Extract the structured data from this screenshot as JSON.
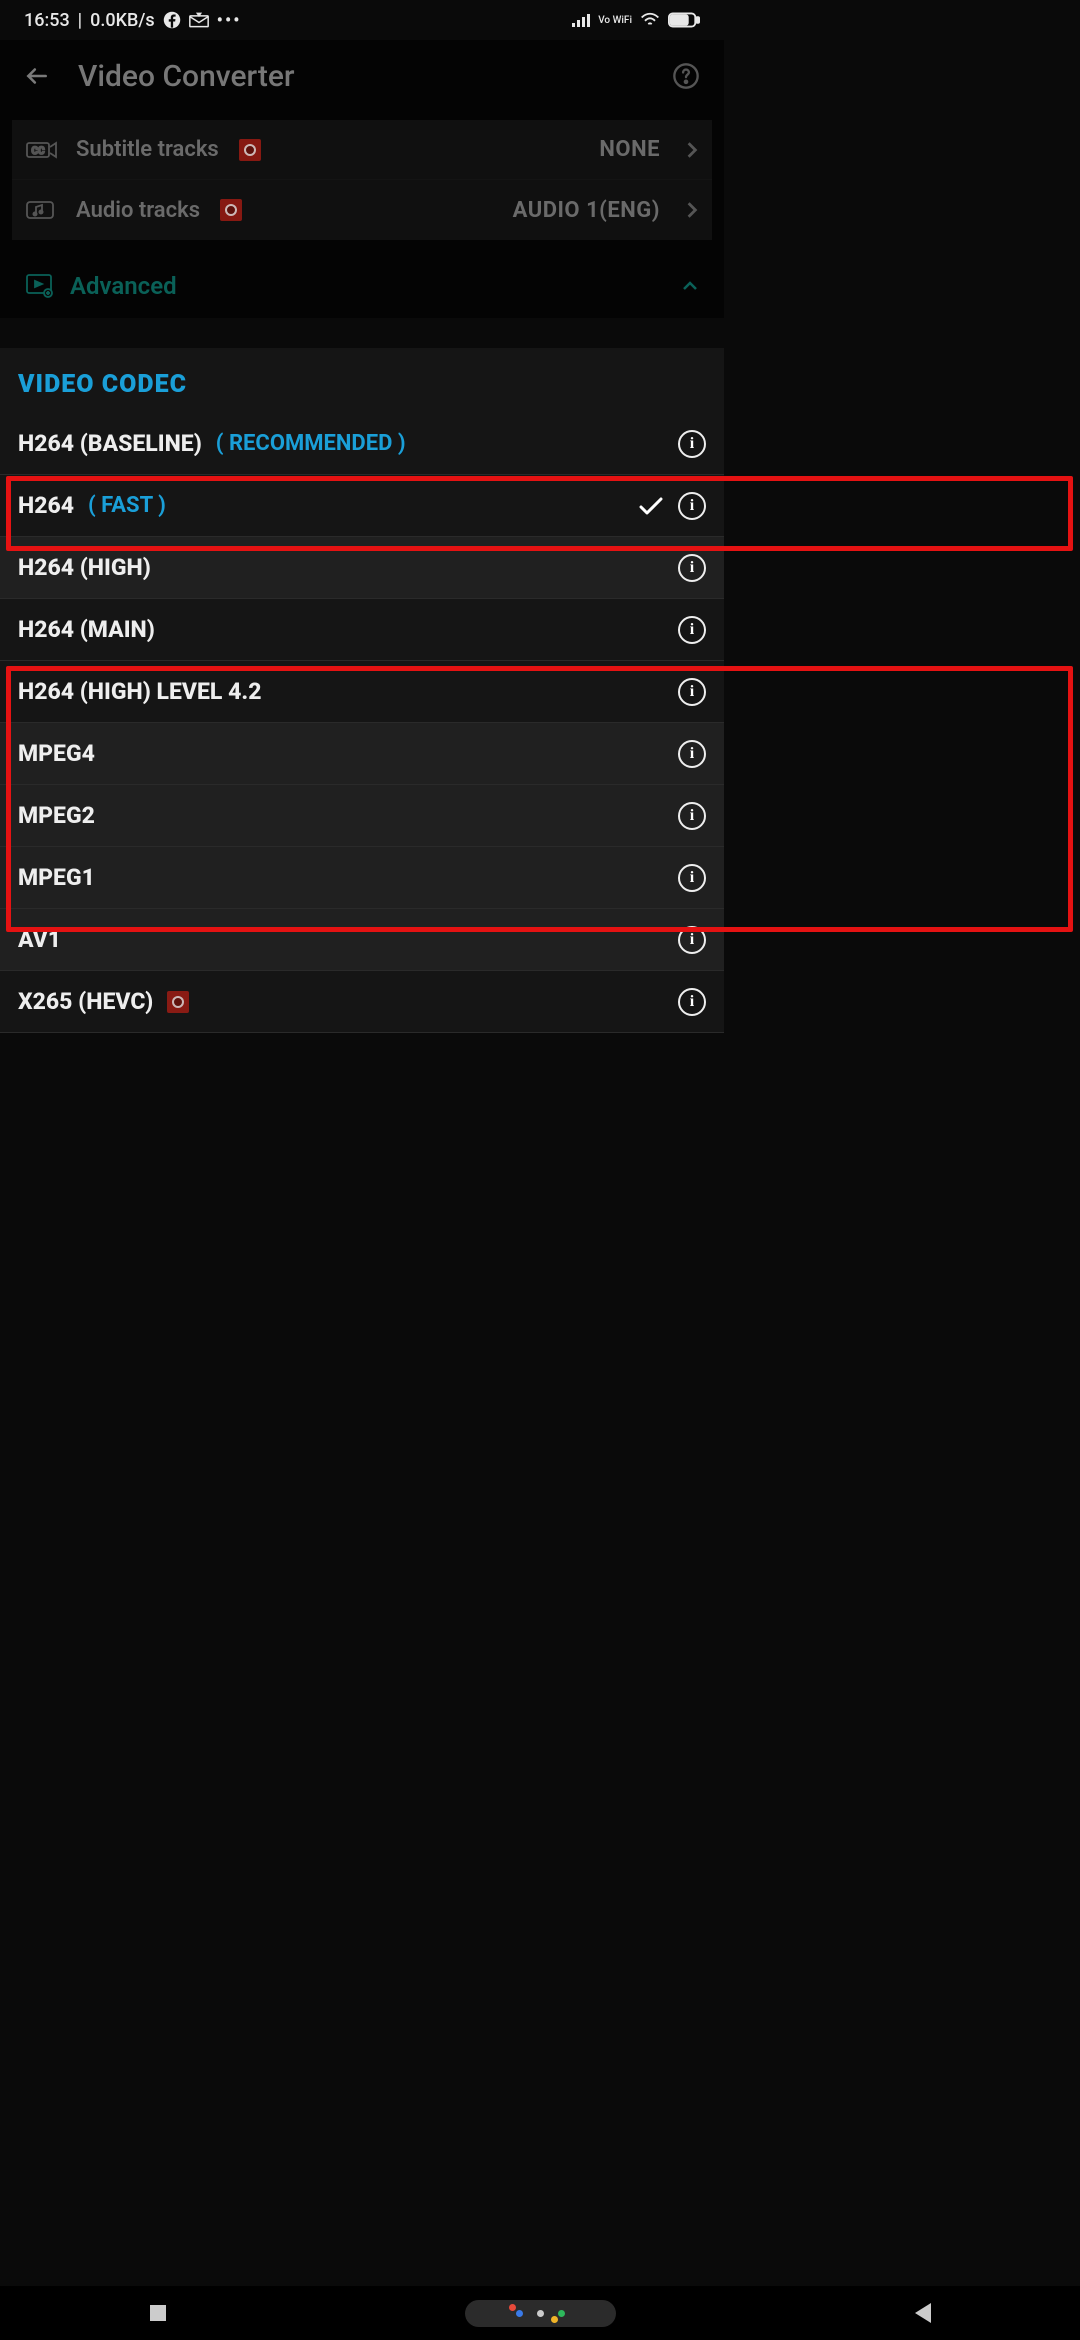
{
  "status": {
    "time": "16:53",
    "net": "0.0KB/s",
    "vowifi": "Vo WiFi"
  },
  "header": {
    "title": "Video Converter"
  },
  "settings": {
    "subtitle": {
      "label": "Subtitle tracks",
      "value": "NONE"
    },
    "audio": {
      "label": "Audio tracks",
      "value": "AUDIO 1(ENG)"
    }
  },
  "advanced": {
    "label": "Advanced"
  },
  "codec": {
    "title": "VIDEO CODEC",
    "items": [
      {
        "name": "H264 (BASELINE)",
        "tag": "( RECOMMENDED )",
        "selected": false,
        "badge": false
      },
      {
        "name": "H264",
        "tag": "( FAST )",
        "selected": true,
        "badge": false
      },
      {
        "name": "H264 (HIGH)",
        "tag": "",
        "selected": false,
        "badge": false
      },
      {
        "name": "H264 (MAIN)",
        "tag": "",
        "selected": false,
        "badge": false
      },
      {
        "name": "H264 (HIGH) LEVEL 4.2",
        "tag": "",
        "selected": false,
        "badge": false
      },
      {
        "name": "MPEG4",
        "tag": "",
        "selected": false,
        "badge": false
      },
      {
        "name": "MPEG2",
        "tag": "",
        "selected": false,
        "badge": false
      },
      {
        "name": "MPEG1",
        "tag": "",
        "selected": false,
        "badge": false
      },
      {
        "name": "AV1",
        "tag": "",
        "selected": false,
        "badge": false
      },
      {
        "name": "X265 (HEVC)",
        "tag": "",
        "selected": false,
        "badge": true
      }
    ]
  }
}
